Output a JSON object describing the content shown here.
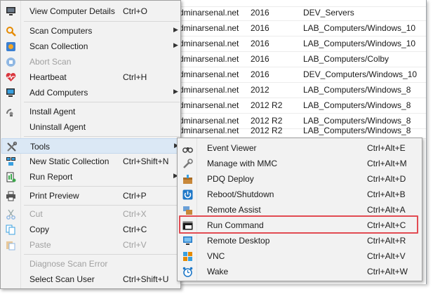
{
  "table": {
    "rows": [
      {
        "domain": "dminarsenal.net",
        "version": "2016",
        "path": "DEV_Servers"
      },
      {
        "domain": "dminarsenal.net",
        "version": "2016",
        "path": "LAB_Computers/Windows_10"
      },
      {
        "domain": "dminarsenal.net",
        "version": "2016",
        "path": "LAB_Computers/Windows_10"
      },
      {
        "domain": "dminarsenal.net",
        "version": "2016",
        "path": "LAB_Computers/Colby"
      },
      {
        "domain": "dminarsenal.net",
        "version": "2016",
        "path": "DEV_Computers/Windows_10"
      },
      {
        "domain": "dminarsenal.net",
        "version": "2012",
        "path": "LAB_Computers/Windows_8"
      },
      {
        "domain": "dminarsenal.net",
        "version": "2012 R2",
        "path": "LAB_Computers/Windows_8"
      },
      {
        "domain": "dminarsenal.net",
        "version": "2012 R2",
        "path": "LAB_Computers/Windows_8"
      },
      {
        "domain": "dminarsenal.net",
        "version": "2012 R2",
        "path": "LAB_Computers/Windows_8"
      }
    ]
  },
  "menu": {
    "view_details": {
      "label": "View Computer Details",
      "shortcut": "Ctrl+O"
    },
    "scan_computers": {
      "label": "Scan Computers"
    },
    "scan_collection": {
      "label": "Scan Collection"
    },
    "abort_scan": {
      "label": "Abort Scan"
    },
    "heartbeat": {
      "label": "Heartbeat",
      "shortcut": "Ctrl+H"
    },
    "add_computers": {
      "label": "Add Computers"
    },
    "install_agent": {
      "label": "Install Agent"
    },
    "uninstall_agent": {
      "label": "Uninstall Agent"
    },
    "tools": {
      "label": "Tools"
    },
    "new_static_collection": {
      "label": "New Static Collection",
      "shortcut": "Ctrl+Shift+N"
    },
    "run_report": {
      "label": "Run Report"
    },
    "print_preview": {
      "label": "Print Preview",
      "shortcut": "Ctrl+P"
    },
    "cut": {
      "label": "Cut",
      "shortcut": "Ctrl+X"
    },
    "copy": {
      "label": "Copy",
      "shortcut": "Ctrl+C"
    },
    "paste": {
      "label": "Paste",
      "shortcut": "Ctrl+V"
    },
    "diagnose_scan_error": {
      "label": "Diagnose Scan Error"
    },
    "select_scan_user": {
      "label": "Select Scan User",
      "shortcut": "Ctrl+Shift+U"
    }
  },
  "tools_submenu": {
    "event_viewer": {
      "label": "Event Viewer",
      "shortcut": "Ctrl+Alt+E"
    },
    "manage_mmc": {
      "label": "Manage with MMC",
      "shortcut": "Ctrl+Alt+M"
    },
    "pdq_deploy": {
      "label": "PDQ Deploy",
      "shortcut": "Ctrl+Alt+D"
    },
    "reboot_shutdown": {
      "label": "Reboot/Shutdown",
      "shortcut": "Ctrl+Alt+B"
    },
    "remote_assist": {
      "label": "Remote Assist",
      "shortcut": "Ctrl+Alt+A"
    },
    "run_command": {
      "label": "Run Command",
      "shortcut": "Ctrl+Alt+C"
    },
    "remote_desktop": {
      "label": "Remote Desktop",
      "shortcut": "Ctrl+Alt+R"
    },
    "vnc": {
      "label": "VNC",
      "shortcut": "Ctrl+Alt+V"
    },
    "wake": {
      "label": "Wake",
      "shortcut": "Ctrl+Alt+W"
    }
  },
  "colors": {
    "highlight_border": "#e24b52",
    "hover_bg": "#dbe8f5",
    "menu_bg": "#f2f2f2",
    "disabled_text": "#a0a0a0"
  }
}
